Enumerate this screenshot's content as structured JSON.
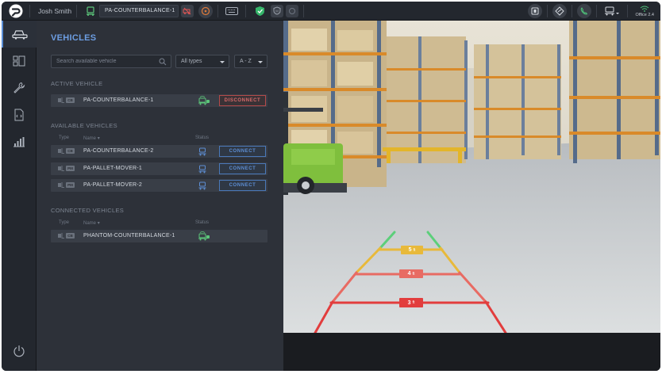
{
  "topbar": {
    "user_name": "Josh Smith",
    "selected_vehicle": "PA-COUNTERBALANCE-1",
    "office_label": "Office 2.4"
  },
  "panel": {
    "title": "VEHICLES",
    "search_placeholder": "Search available vehicle",
    "type_filter": "All types",
    "sort_filter": "A - Z",
    "active_section": "ACTIVE VEHICLE",
    "available_section": "AVAILABLE VEHICLES",
    "connected_section": "CONNECTED VEHICLES",
    "col_type": "Type",
    "col_name": "Name",
    "col_status": "Status",
    "active_vehicle": {
      "badge": "CB",
      "name": "PA-COUNTERBALANCE-1",
      "action": "DISCONNECT"
    },
    "available_vehicles": [
      {
        "badge": "CB",
        "name": "PA-COUNTERBALANCE-2",
        "action": "CONNECT"
      },
      {
        "badge": "PM",
        "name": "PA-PALLET-MOVER-1",
        "action": "CONNECT"
      },
      {
        "badge": "PM",
        "name": "PA-PALLET-MOVER-2",
        "action": "CONNECT"
      }
    ],
    "connected_vehicles": [
      {
        "badge": "CB",
        "name": "PHANTOM-COUNTERBALANCE-1"
      }
    ]
  },
  "camera": {
    "guides": [
      {
        "label": "5",
        "unit": "ft",
        "color": "#e8b93a"
      },
      {
        "label": "4",
        "unit": "ft",
        "color": "#e86b63"
      },
      {
        "label": "3",
        "unit": "ft",
        "color": "#e23d3d"
      }
    ]
  },
  "colors": {
    "accent": "#6d9ee3",
    "connect": "#5d8ed4",
    "disconnect": "#d86a6a",
    "online": "#5cc67a"
  }
}
